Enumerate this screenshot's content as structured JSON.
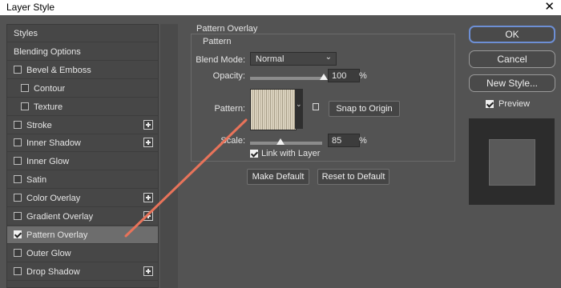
{
  "window": {
    "title": "Layer Style",
    "close_glyph": "✕"
  },
  "styles_panel": {
    "items": [
      {
        "label": "Styles",
        "has_checkbox": false,
        "checked": false,
        "has_plus": false,
        "selected": false
      },
      {
        "label": "Blending Options",
        "has_checkbox": false,
        "checked": false,
        "has_plus": false,
        "selected": false
      },
      {
        "label": "Bevel & Emboss",
        "has_checkbox": true,
        "checked": false,
        "has_plus": false,
        "selected": false
      },
      {
        "label": "Contour",
        "has_checkbox": true,
        "checked": false,
        "has_plus": false,
        "selected": false,
        "indent": true
      },
      {
        "label": "Texture",
        "has_checkbox": true,
        "checked": false,
        "has_plus": false,
        "selected": false,
        "indent": true
      },
      {
        "label": "Stroke",
        "has_checkbox": true,
        "checked": false,
        "has_plus": true,
        "selected": false
      },
      {
        "label": "Inner Shadow",
        "has_checkbox": true,
        "checked": false,
        "has_plus": true,
        "selected": false
      },
      {
        "label": "Inner Glow",
        "has_checkbox": true,
        "checked": false,
        "has_plus": false,
        "selected": false
      },
      {
        "label": "Satin",
        "has_checkbox": true,
        "checked": false,
        "has_plus": false,
        "selected": false
      },
      {
        "label": "Color Overlay",
        "has_checkbox": true,
        "checked": false,
        "has_plus": true,
        "selected": false
      },
      {
        "label": "Gradient Overlay",
        "has_checkbox": true,
        "checked": false,
        "has_plus": true,
        "selected": false
      },
      {
        "label": "Pattern Overlay",
        "has_checkbox": true,
        "checked": true,
        "has_plus": false,
        "selected": true
      },
      {
        "label": "Outer Glow",
        "has_checkbox": true,
        "checked": false,
        "has_plus": false,
        "selected": false
      },
      {
        "label": "Drop Shadow",
        "has_checkbox": true,
        "checked": false,
        "has_plus": true,
        "selected": false
      }
    ]
  },
  "pattern_overlay": {
    "group_title": "Pattern Overlay",
    "sub_title": "Pattern",
    "blend_mode_label": "Blend Mode:",
    "blend_mode_value": "Normal",
    "opacity_label": "Opacity:",
    "opacity_value": "100",
    "opacity_level_percent": 100,
    "percent": "%",
    "pattern_label": "Pattern:",
    "snap_to_origin": "Snap to Origin",
    "scale_label": "Scale:",
    "scale_value": "85",
    "scale_level_percent": 85,
    "link_with_layer": "Link with Layer",
    "link_checked": true,
    "make_default": "Make Default",
    "reset_to_default": "Reset to Default"
  },
  "actions": {
    "ok": "OK",
    "cancel": "Cancel",
    "new_style": "New Style...",
    "preview_label": "Preview",
    "preview_checked": true
  },
  "annotation": {
    "color": "#e8735a"
  },
  "icons": {
    "close": "close-icon",
    "dropdown": "chevron-down-icon",
    "new_preset": "new-preset-icon",
    "plus": "add-effect-icon"
  }
}
